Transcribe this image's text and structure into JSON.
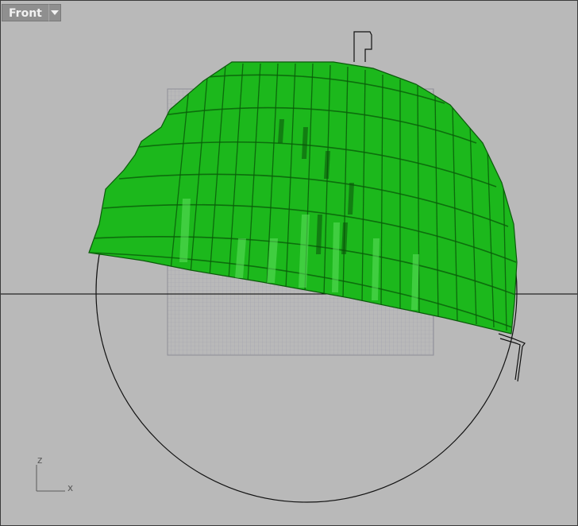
{
  "viewport": {
    "name": "Front",
    "menu_icon": "chevron-down-icon"
  },
  "axes": {
    "z_label": "z",
    "x_label": "x"
  },
  "colors": {
    "background": "#b9b9b9",
    "surface": "#18b418",
    "surface_edge": "#0b5a0b",
    "grid": "#9a9aa6",
    "curve": "#111111"
  }
}
